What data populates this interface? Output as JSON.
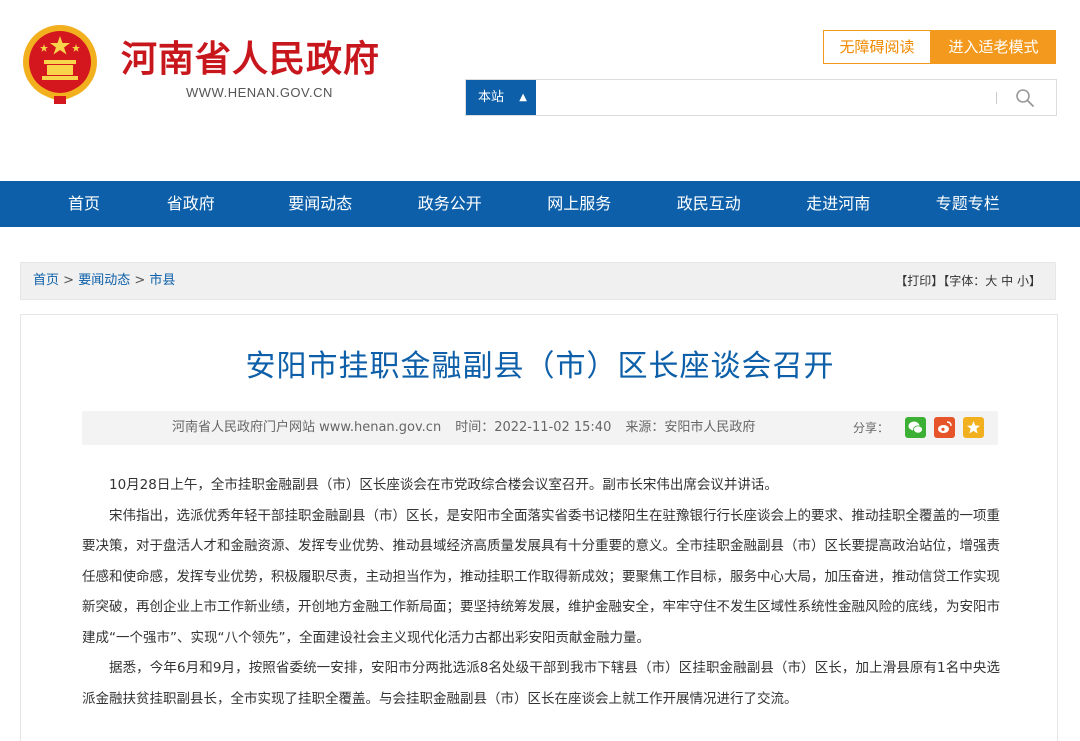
{
  "header": {
    "site_title": "河南省人民政府",
    "site_domain": "WWW.HENAN.GOV.CN",
    "accessibility_label": "无障碍阅读",
    "elder_mode_label": "进入适老模式",
    "search_scope": "本站",
    "search_placeholder": ""
  },
  "nav": {
    "items": [
      "首页",
      "省政府",
      "要闻动态",
      "政务公开",
      "网上服务",
      "政民互动",
      "走进河南",
      "专题专栏"
    ]
  },
  "breadcrumb": {
    "home": "首页",
    "sep1": " > ",
    "section": "要闻动态",
    "sep2": " > ",
    "current": "市县"
  },
  "tools": {
    "print": "【打印】",
    "font_prefix": "【字体：",
    "font_large": "大",
    "font_medium": "中",
    "font_small": "小",
    "font_suffix": "】"
  },
  "article": {
    "title": "安阳市挂职金融副县（市）区长座谈会召开",
    "publisher": "河南省人民政府门户网站 www.henan.gov.cn",
    "time": "时间：2022-11-02 15:40",
    "source": "来源：安阳市人民政府",
    "share_label": "分享：",
    "paragraphs": [
      "10月28日上午，全市挂职金融副县（市）区长座谈会在市党政综合楼会议室召开。副市长宋伟出席会议并讲话。",
      "宋伟指出，选派优秀年轻干部挂职金融副县（市）区长，是安阳市全面落实省委书记楼阳生在驻豫银行行长座谈会上的要求、推动挂职全覆盖的一项重要决策，对于盘活人才和金融资源、发挥专业优势、推动县域经济高质量发展具有十分重要的意义。全市挂职金融副县（市）区长要提高政治站位，增强责任感和使命感，发挥专业优势，积极履职尽责，主动担当作为，推动挂职工作取得新成效；要聚焦工作目标，服务中心大局，加压奋进，推动信贷工作实现新突破，再创企业上市工作新业绩，开创地方金融工作新局面；要坚持统筹发展，维护金融安全，牢牢守住不发生区域性系统性金融风险的底线，为安阳市建成“一个强市”、实现“八个领先”，全面建设社会主义现代化活力古都出彩安阳贡献金融力量。",
      "据悉，今年6月和9月，按照省委统一安排，安阳市分两批选派8名处级干部到我市下辖县（市）区挂职金融副县（市）区长，加上滑县原有1名中央选派金融扶贫挂职副县长，全市实现了挂职全覆盖。与会挂职金融副县（市）区长在座谈会上就工作开展情况进行了交流。"
    ]
  },
  "colors": {
    "brand_red": "#c8161d",
    "nav_blue": "#0c5fa8",
    "accent_orange": "#f39a1e"
  }
}
